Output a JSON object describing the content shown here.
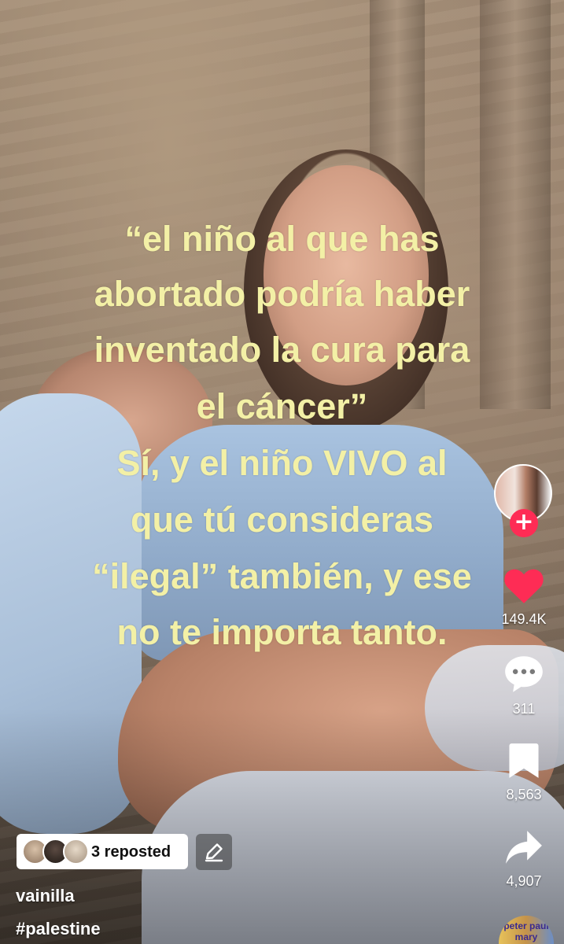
{
  "caption": {
    "lines": [
      "“el niño al que has",
      "abortado podría haber",
      "inventado la cura para",
      "el cáncer”",
      "Sí, y el niño VIVO al",
      "que tú consideras",
      "“ilegal” también, y ese",
      "no te importa tanto."
    ],
    "color": "#f3f0a6"
  },
  "actions": {
    "follow_symbol": "+",
    "like_count": "149.4K",
    "comment_count": "311",
    "save_count": "8,563",
    "share_count": "4,907"
  },
  "repost": {
    "label": "3 reposted"
  },
  "post": {
    "username": "vainilla",
    "hashtag": "#palestine"
  },
  "music_disc_text": "peter paul mary",
  "colors": {
    "like": "#fe2c55",
    "follow": "#fe2c55",
    "icon": "#ffffff"
  },
  "icons": [
    "heart-icon",
    "comment-icon",
    "bookmark-icon",
    "share-icon",
    "edit-pencil-icon",
    "plus-icon"
  ]
}
